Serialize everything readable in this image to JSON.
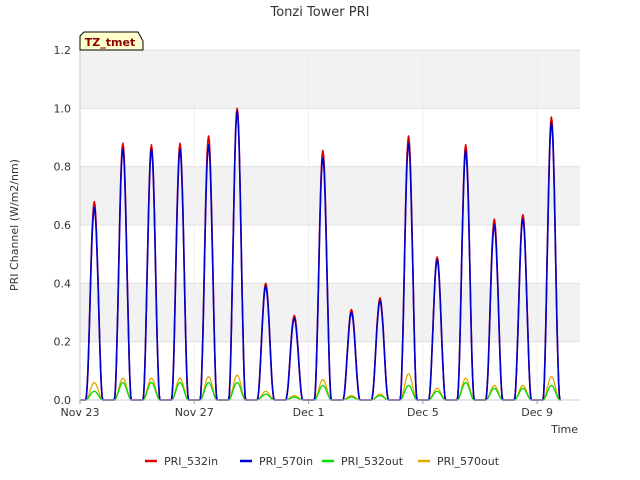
{
  "chart_data": {
    "type": "line",
    "title": "Tonzi Tower PRI",
    "xlabel": "Time",
    "ylabel": "PRI Channel (W/m2/nm)",
    "badge": "TZ_tmet",
    "xlim": [
      0,
      17.5
    ],
    "ylim": [
      0,
      1.2
    ],
    "x_ticks": [
      {
        "x": 0,
        "label": "Nov 23"
      },
      {
        "x": 4,
        "label": "Nov 27"
      },
      {
        "x": 8,
        "label": "Dec 1"
      },
      {
        "x": 12,
        "label": "Dec 5"
      },
      {
        "x": 16,
        "label": "Dec 9"
      }
    ],
    "y_ticks": [
      {
        "v": 0.0,
        "label": "0.0"
      },
      {
        "v": 0.2,
        "label": "0.2"
      },
      {
        "v": 0.4,
        "label": "0.4"
      },
      {
        "v": 0.6,
        "label": "0.6"
      },
      {
        "v": 0.8,
        "label": "0.8"
      },
      {
        "v": 1.0,
        "label": "1.0"
      },
      {
        "v": 1.2,
        "label": "1.2"
      }
    ],
    "grid": true,
    "legend_position": "bottom",
    "day_peaks": [
      {
        "day": 0,
        "in532": 0.68,
        "in570": 0.66,
        "o532": 0.03,
        "o570": 0.06
      },
      {
        "day": 1,
        "in532": 0.88,
        "in570": 0.86,
        "o532": 0.06,
        "o570": 0.075
      },
      {
        "day": 2,
        "in532": 0.875,
        "in570": 0.86,
        "o532": 0.06,
        "o570": 0.075
      },
      {
        "day": 3,
        "in532": 0.88,
        "in570": 0.86,
        "o532": 0.06,
        "o570": 0.075
      },
      {
        "day": 4,
        "in532": 0.905,
        "in570": 0.875,
        "o532": 0.06,
        "o570": 0.08
      },
      {
        "day": 5,
        "in532": 1.0,
        "in570": 0.99,
        "o532": 0.06,
        "o570": 0.085
      },
      {
        "day": 6,
        "in532": 0.4,
        "in570": 0.39,
        "o532": 0.02,
        "o570": 0.03
      },
      {
        "day": 7,
        "in532": 0.29,
        "in570": 0.28,
        "o532": 0.01,
        "o570": 0.015
      },
      {
        "day": 8,
        "in532": 0.855,
        "in570": 0.83,
        "o532": 0.05,
        "o570": 0.07
      },
      {
        "day": 9,
        "in532": 0.31,
        "in570": 0.3,
        "o532": 0.01,
        "o570": 0.015
      },
      {
        "day": 10,
        "in532": 0.35,
        "in570": 0.34,
        "o532": 0.015,
        "o570": 0.02
      },
      {
        "day": 11,
        "in532": 0.905,
        "in570": 0.88,
        "o532": 0.05,
        "o570": 0.09
      },
      {
        "day": 12,
        "in532": 0.49,
        "in570": 0.48,
        "o532": 0.03,
        "o570": 0.04
      },
      {
        "day": 13,
        "in532": 0.875,
        "in570": 0.855,
        "o532": 0.06,
        "o570": 0.075
      },
      {
        "day": 14,
        "in532": 0.62,
        "in570": 0.6,
        "o532": 0.04,
        "o570": 0.05
      },
      {
        "day": 15,
        "in532": 0.635,
        "in570": 0.62,
        "o532": 0.04,
        "o570": 0.05
      },
      {
        "day": 16,
        "in532": 0.97,
        "in570": 0.95,
        "o532": 0.05,
        "o570": 0.08
      }
    ],
    "series": [
      {
        "key": "in532",
        "name": "PRI_532in",
        "color": "#dd0000"
      },
      {
        "key": "in570",
        "name": "PRI_570in",
        "color": "#0000cc"
      },
      {
        "key": "o532",
        "name": "PRI_532out",
        "color": "#00dd00"
      },
      {
        "key": "o570",
        "name": "PRI_570out",
        "color": "#e6a800"
      }
    ]
  }
}
